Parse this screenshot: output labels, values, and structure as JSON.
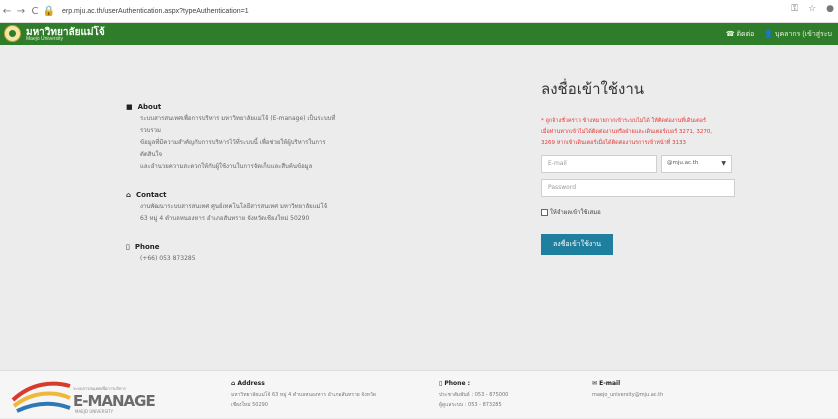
{
  "browser": {
    "url": "erp.mju.ac.th/userAuthentication.aspx?typeAuthentication=1"
  },
  "header": {
    "title": "มหาวิทยาลัยแม่โจ้",
    "subtitle": "Maejo University",
    "contact_label": "ติดต่อ",
    "user_label": "บุคลากร (เข้าสู่ระบ"
  },
  "info": {
    "about_title": "About",
    "about_lines": [
      "ระบบสารสนเทศเพื่อการบริหาร มหาวิทยาลัยแม่โจ้ (E-manage) เป็นระบบที่รวบรวม",
      "ข้อมูลที่มีความสำคัญกับการบริหารไว้ที่ระบบนี้ เพื่อช่วยให้ผู้บริหารในการตัดสินใจ",
      "และอำนวยความสะดวกให้กับผู้ใช้งานในการจัดเก็บและสืบค้นข้อมูล"
    ],
    "contact_title": "Contact",
    "contact_lines": [
      "งานพัฒนาระบบสารสนเทศ ศูนย์เทคโนโลยีสารสนเทศ มหาวิทยาลัยแม่โจ้",
      "63 หมู่ 4 ตำบลหนองหาร อำเภอสันทราย จังหวัดเชียงใหม่ 50290"
    ],
    "phone_title": "Phone",
    "phone_number": "(+66) 053 873285"
  },
  "login": {
    "title": "ลงชื่อเข้าใช้งาน",
    "warning_lines": [
      "* ลูกจ้างชั่วคราว ข้างหมายกากเข้าระบบไม่ได้ ให้ติดต่องานที่เดินเตอร์",
      "เมื่อท่านหากเข้าไม่ได้ติดต่องานหรือฝ่ายและเดินเตอร์เบอร์ 3271, 3270,",
      "3269 หากเข้าเดินเตอร์เมื่อได้ติดต่องานรการเข้าหน้าที่ 3133"
    ],
    "email_placeholder": "E-mail",
    "domain_value": "@mju.ac.th",
    "password_placeholder": "Password",
    "remember_label": "ให้จำผลเข้าใช้เสมอ",
    "button_label": "ลงชื่อเข้าใช้งาน"
  },
  "footer": {
    "logo_subtitle": "ระบบสารสนเทศเพื่อการบริหาร",
    "logo_text": "E-MANAGE",
    "logo_university": "MAEJO UNIVERSITY",
    "address_title": "Address",
    "address_lines": [
      "มหาวิทยาลัยแม่โจ้ 63 หมู่ 4 ตำบลหนองหาร อำเภอสันทราย จังหวัด",
      "เชียงใหม่ 50290"
    ],
    "phone_title": "Phone :",
    "phone_lines": [
      "ประชาสัมพันธ์ : 053 - 875000",
      "ผู้ดูแลระบบ : 053 - 873285"
    ],
    "email_title": "E-mail",
    "email_value": "maejo_university@mju.ac.th"
  },
  "colors": {
    "header_green": "#2f7d2b",
    "button_blue": "#1f7f9f",
    "warning_red": "#e53935"
  }
}
